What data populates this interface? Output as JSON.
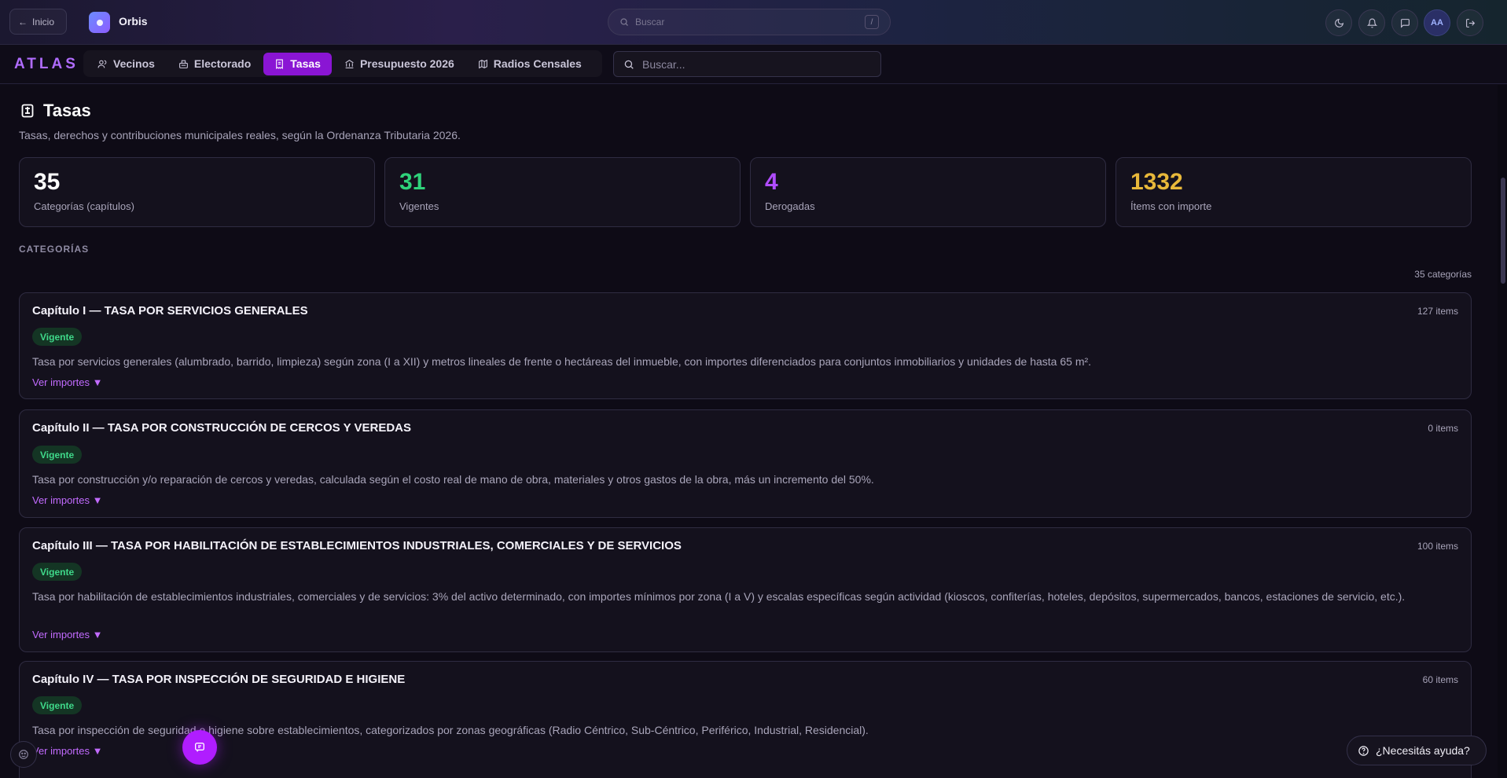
{
  "topbar": {
    "back_label": "Inicio",
    "app_name": "Orbis",
    "search_placeholder": "Buscar",
    "search_shortcut": "/",
    "avatar_initials": "AA"
  },
  "nav": {
    "brand": "ATLAS",
    "tabs": [
      {
        "label": "Vecinos",
        "icon": "users-icon"
      },
      {
        "label": "Electorado",
        "icon": "ballot-box-icon"
      },
      {
        "label": "Tasas",
        "icon": "receipt-icon",
        "active": true
      },
      {
        "label": "Presupuesto 2026",
        "icon": "bank-icon"
      },
      {
        "label": "Radios Censales",
        "icon": "map-icon"
      }
    ],
    "search_placeholder": "Buscar..."
  },
  "page": {
    "title": "Tasas",
    "subtitle": "Tasas, derechos y contribuciones municipales reales, según la Ordenanza Tributaria 2026."
  },
  "stats": [
    {
      "value": "35",
      "label": "Categorías (capítulos)",
      "color": "#ffffff"
    },
    {
      "value": "31",
      "label": "Vigentes",
      "color": "#2fd27a"
    },
    {
      "value": "4",
      "label": "Derogadas",
      "color": "#b04cff"
    },
    {
      "value": "1332",
      "label": "Ítems con importe",
      "color": "#e8b83a"
    }
  ],
  "section": {
    "label": "CATEGORÍAS",
    "count": "35 categorías"
  },
  "categories": [
    {
      "title": "Capítulo I — TASA POR SERVICIOS GENERALES",
      "items": "127 items",
      "status": "Vigente",
      "description": "Tasa por servicios generales (alumbrado, barrido, limpieza) según zona (I a XII) y metros lineales de frente o hectáreas del inmueble, con importes diferenciados para conjuntos inmobiliarios y unidades de hasta 65 m².",
      "link": "Ver importes ▼"
    },
    {
      "title": "Capítulo II — TASA POR CONSTRUCCIÓN DE CERCOS Y VEREDAS",
      "items": "0 items",
      "status": "Vigente",
      "description": "Tasa por construcción y/o reparación de cercos y veredas, calculada según el costo real de mano de obra, materiales y otros gastos de la obra, más un incremento del 50%.",
      "link": "Ver importes ▼"
    },
    {
      "title": "Capítulo III — TASA POR HABILITACIÓN DE ESTABLECIMIENTOS INDUSTRIALES, COMERCIALES Y DE SERVICIOS",
      "items": "100 items",
      "status": "Vigente",
      "description": "Tasa por habilitación de establecimientos industriales, comerciales y de servicios: 3% del activo determinado, con importes mínimos por zona (I a V) y escalas específicas según actividad (kioscos, confiterías, hoteles, depósitos, supermercados, bancos, estaciones de servicio, etc.).",
      "link": "Ver importes ▼"
    },
    {
      "title": "Capítulo IV — TASA POR INSPECCIÓN DE SEGURIDAD E HIGIENE",
      "items": "60 items",
      "status": "Vigente",
      "description": "Tasa por inspección de seguridad e higiene sobre establecimientos, categorizados por zonas geográficas (Radio Céntrico, Sub-Céntrico, Periférico, Industrial, Residencial).",
      "link": "Ver importes ▼"
    }
  ],
  "help": {
    "label": "¿Necesitás ayuda?"
  }
}
